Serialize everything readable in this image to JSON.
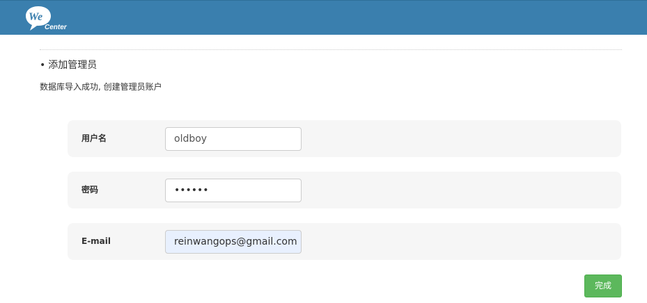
{
  "header": {
    "logo_text_top": "We",
    "logo_text_bottom": "Center",
    "background_color": "#3a7fae"
  },
  "section": {
    "bullet": "•",
    "title": "添加管理员",
    "subtitle": "数据库导入成功, 创建管理员账户"
  },
  "form": {
    "username": {
      "label": "用户名",
      "value": "oldboy"
    },
    "password": {
      "label": "密码",
      "value": "••••••"
    },
    "email": {
      "label": "E-mail",
      "value": "reinwangops@gmail.com"
    }
  },
  "actions": {
    "finish_label": "完成",
    "finish_color": "#5cb85c"
  }
}
